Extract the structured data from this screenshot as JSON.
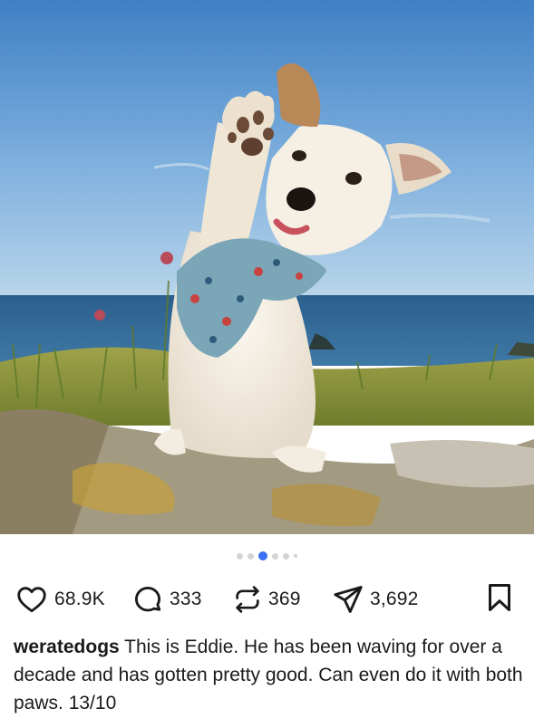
{
  "post": {
    "image": {
      "subject": "dog-waving-photo",
      "carousel_slides": 6,
      "carousel_active_index": 2
    },
    "actions": {
      "likes": "68.9K",
      "comments": "333",
      "reposts": "369",
      "shares": "3,692"
    },
    "caption": {
      "username": "weratedogs",
      "text": "This is Eddie. He has been waving for over a decade and has gotten pretty good. Can even do it with both paws. 13/10"
    }
  },
  "colors": {
    "carousel_active": "#3b6ff5",
    "carousel_inactive": "#d4d4d4",
    "icon": "#1a1a1a"
  }
}
